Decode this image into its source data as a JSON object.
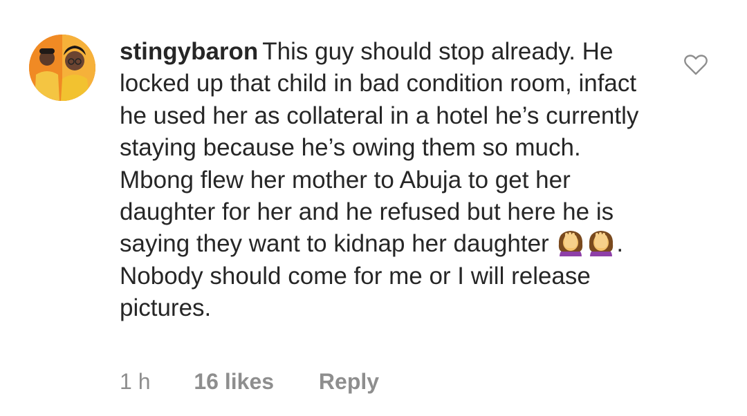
{
  "comment": {
    "username": "stingybaron",
    "text_before_emoji": "This guy should stop already. He locked up that child in bad condition room, infact he used her as collateral in a hotel he’s currently staying because he’s owing them so much. Mbong flew her mother to Abuja to get her daughter for her and he refused but here he is saying they want to kidnap her daughter ",
    "emojis": [
      "face-palm-emoji",
      "face-palm-emoji"
    ],
    "text_after_emoji": ". Nobody should come for me or I will release pictures.",
    "avatar_icon": "profile-avatar-icon",
    "like_icon": "heart-outline-icon"
  },
  "meta": {
    "time": "1 h",
    "likes": "16 likes",
    "reply": "Reply"
  },
  "colors": {
    "text": "#262626",
    "secondary": "#8e8e8e",
    "avatar_bg": "#f08a24"
  }
}
